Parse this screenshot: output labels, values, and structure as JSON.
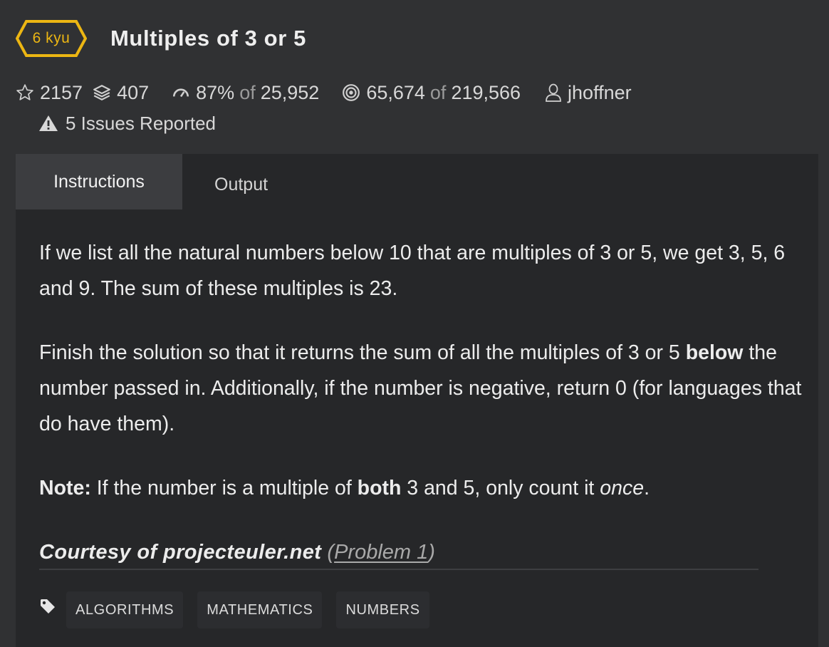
{
  "kata": {
    "rank": "6 kyu",
    "rank_color": "#ecb613",
    "title": "Multiples of 3 or 5"
  },
  "stats": {
    "stars": "2157",
    "collections": "407",
    "satisfaction_percent": "87%",
    "satisfaction_of": "of",
    "satisfaction_votes": "25,952",
    "completed": "65,674",
    "completed_of": "of",
    "attempted": "219,566",
    "author": "jhoffner",
    "issues": "5 Issues Reported"
  },
  "tabs": [
    {
      "label": "Instructions",
      "active": true
    },
    {
      "label": "Output",
      "active": false
    }
  ],
  "instructions": {
    "p1": "If we list all the natural numbers below 10 that are multiples of 3 or 5, we get 3, 5, 6 and 9. The sum of these multiples is 23.",
    "p2_part1": "Finish the solution so that it returns the sum of all the multiples of 3 or 5 ",
    "p2_bold": "below",
    "p2_part2": " the number passed in. Additionally, if the number is negative, return 0 (for languages that do have them).",
    "p3_label": "Note:",
    "p3_part1": " If the number is a multiple of ",
    "p3_bold": "both",
    "p3_part2": " 3 and 5, only count it ",
    "p3_em": "once",
    "p3_end": ".",
    "courtesy": "Courtesy of projecteuler.net",
    "courtesy_open": " (",
    "courtesy_link": "Problem 1",
    "courtesy_close": ")"
  },
  "tags": [
    "ALGORITHMS",
    "MATHEMATICS",
    "NUMBERS"
  ],
  "icons": {
    "star": "star-icon",
    "collection": "stack-icon",
    "satisfaction": "gauge-icon",
    "completion": "target-icon",
    "author": "user-icon",
    "issues": "warning-icon",
    "tags": "tag-icon"
  }
}
